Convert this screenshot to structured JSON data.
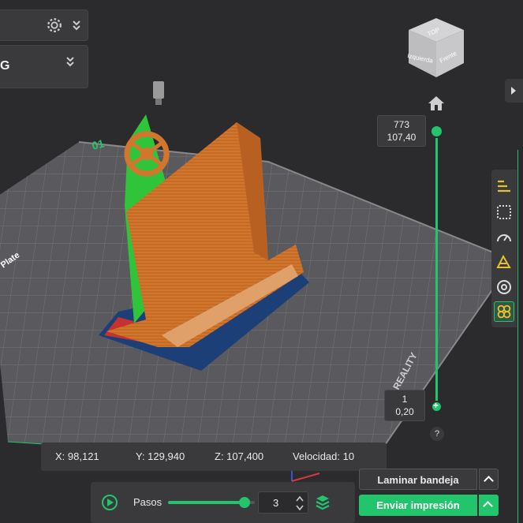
{
  "top_panel": {
    "profile_label": "G"
  },
  "view_cube": {
    "top": "TOP",
    "left": "Izquierda",
    "front": "Frente"
  },
  "layer_slider": {
    "top_layer": "773",
    "top_height": "107,40",
    "bottom_layer": "1",
    "bottom_height": "0,20",
    "help": "?"
  },
  "plate": {
    "plate_number": "01",
    "plate_label": "Plate",
    "brand": "REALITY"
  },
  "coords": {
    "x": "X: 98,121",
    "y": "Y: 129,940",
    "z": "Z: 107,400",
    "speed": "Velocidad: 10"
  },
  "playback": {
    "steps_label": "Pasos",
    "step_value": "3",
    "progress": 0.85
  },
  "actions": {
    "slice_label": "Laminar bandeja",
    "print_label": "Enviar impresión"
  },
  "colors": {
    "accent": "#22c56b",
    "model": "#d2762e",
    "support": "#2fc43a",
    "plate": "#5a5a5e"
  },
  "icons": {
    "settings": "gear-icon",
    "collapse": "double-chevron-down-icon",
    "home": "home-icon",
    "play": "play-icon",
    "layers": "layers-icon"
  }
}
